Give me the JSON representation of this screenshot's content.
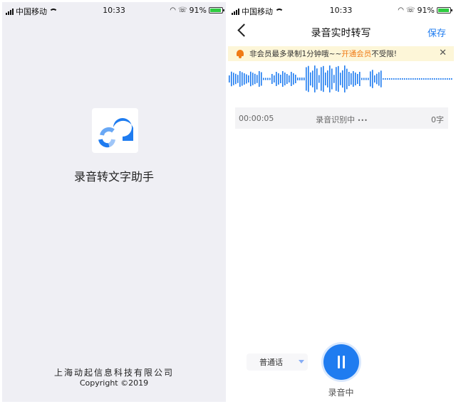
{
  "left_screen": {
    "status": {
      "carrier": "中国移动",
      "time": "10:33",
      "battery": "91%"
    },
    "app_name": "录音转文字助手",
    "company": "上海动起信息科技有限公司",
    "copyright": "Copyright ©2019"
  },
  "right_screen": {
    "status": {
      "carrier": "中国移动",
      "time": "10:33",
      "battery": "91%"
    },
    "nav": {
      "title": "录音实时转写",
      "save": "保存"
    },
    "notice": {
      "pre": "非会员最多录制1分钟哦~~",
      "link": "开通会员",
      "post": "不受限!",
      "close": "✕"
    },
    "panel": {
      "time": "00:00:05",
      "status": "录音识别中",
      "dots": "•••",
      "word_count": "0字"
    },
    "language": "普通话",
    "record_label": "录音中"
  },
  "colors": {
    "accent": "#1f7cf0",
    "notice_bg": "#fdf6d8",
    "notice_accent": "#f07b16",
    "splash_bg": "#efeff4"
  }
}
